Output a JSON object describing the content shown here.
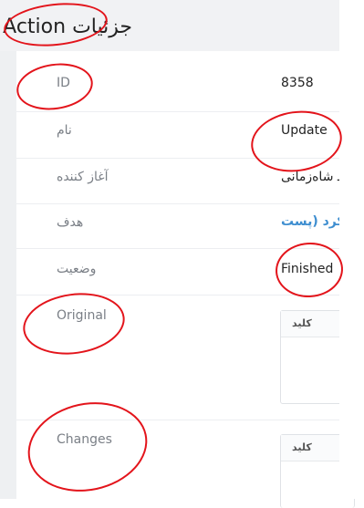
{
  "header": {
    "title": "جزئیات Action"
  },
  "fields": [
    {
      "label": "ID",
      "value": "8358"
    },
    {
      "label": "نام",
      "value": "Update"
    },
    {
      "label": "آغاز کننده",
      "value": "ـ شاه‌زمانی"
    },
    {
      "label": "هدف",
      "value": "کرد (پست"
    },
    {
      "label": "وضعیت",
      "value": "Finished"
    }
  ],
  "original": {
    "label": "Original",
    "column_header": "کلید"
  },
  "changes": {
    "label": "Changes",
    "column_header": "کلید"
  },
  "colors": {
    "link": "#3e8ed0",
    "annotation": "#e3141b"
  }
}
